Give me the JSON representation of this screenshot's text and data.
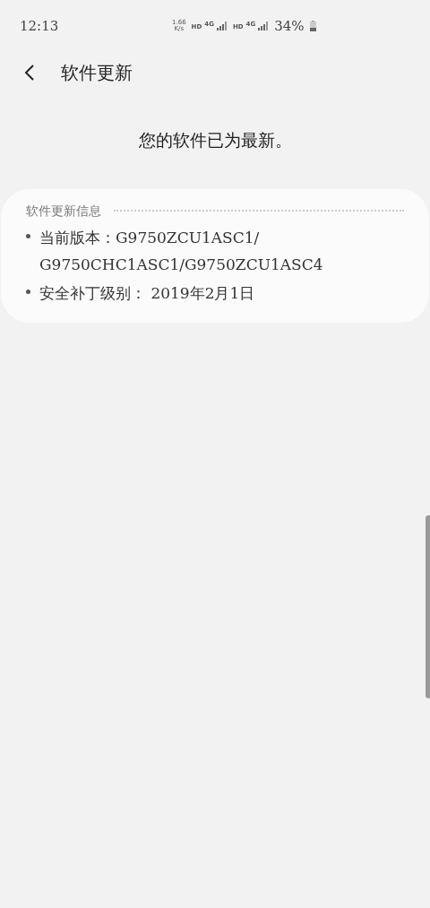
{
  "status_bar": {
    "time": "12:13",
    "speed_value": "1.66",
    "speed_unit": "K/s",
    "sim_1": {
      "hd": "HD",
      "network": "4G"
    },
    "sim_2": {
      "hd": "HD",
      "network": "4G"
    },
    "battery": "34%"
  },
  "header": {
    "title": "软件更新"
  },
  "message": "您的软件已为最新。",
  "info": {
    "title": "软件更新信息",
    "items": [
      "当前版本：G9750ZCU1ASC1/ G9750CHC1ASC1/G9750ZCU1ASC4",
      "安全补丁级别： 2019年2月1日"
    ]
  }
}
